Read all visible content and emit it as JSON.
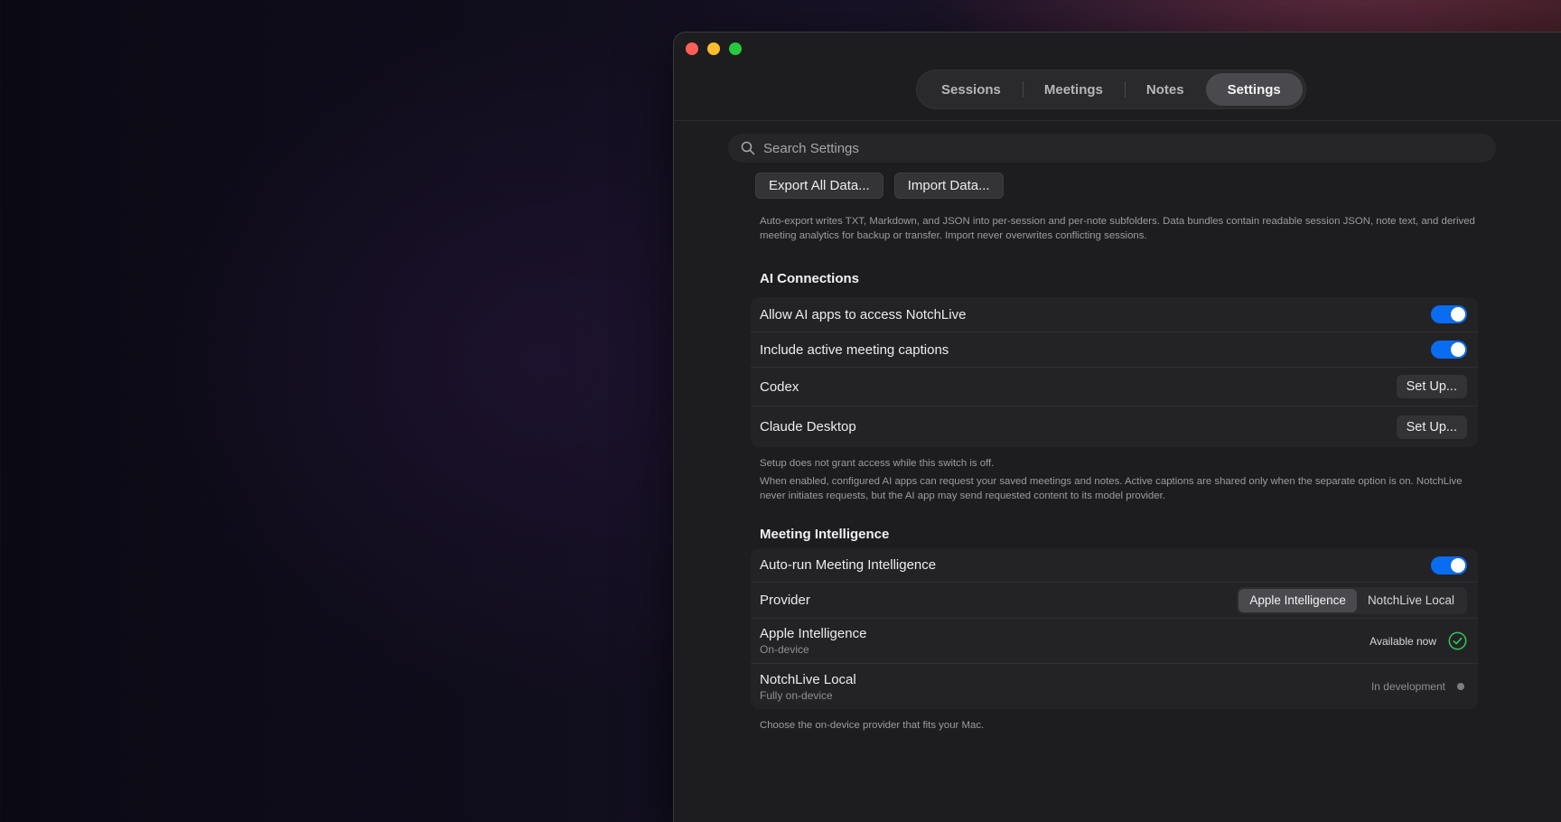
{
  "tabs": [
    {
      "label": "Sessions",
      "active": false
    },
    {
      "label": "Meetings",
      "active": false
    },
    {
      "label": "Notes",
      "active": false
    },
    {
      "label": "Settings",
      "active": true
    }
  ],
  "search": {
    "placeholder": "Search Settings",
    "value": ""
  },
  "data_buttons": {
    "export_label": "Export All Data...",
    "import_label": "Import Data..."
  },
  "data_note": "Auto-export writes TXT, Markdown, and JSON into per-session and per-note subfolders. Data bundles contain readable session JSON, note text, and derived meeting analytics for backup or transfer. Import never overwrites conflicting sessions.",
  "ai_connections": {
    "title": "AI Connections",
    "allow_label": "Allow AI apps to access NotchLive",
    "allow_on": true,
    "captions_label": "Include active meeting captions",
    "captions_on": true,
    "codex_label": "Codex",
    "codex_button": "Set Up...",
    "claude_label": "Claude Desktop",
    "claude_button": "Set Up...",
    "note1": "Setup does not grant access while this switch is off.",
    "note2": "When enabled, configured AI apps can request your saved meetings and notes. Active captions are shared only when the separate option is on. NotchLive never initiates requests, but the AI app may send requested content to its model provider."
  },
  "meeting_intelligence": {
    "title": "Meeting Intelligence",
    "autorun_label": "Auto-run Meeting Intelligence",
    "autorun_on": true,
    "provider_label": "Provider",
    "provider_options": [
      "Apple Intelligence",
      "NotchLive Local"
    ],
    "provider_selected": "Apple Intelligence",
    "apple": {
      "name": "Apple Intelligence",
      "sub": "On-device",
      "status": "Available now"
    },
    "local": {
      "name": "NotchLive Local",
      "sub": "Fully on-device",
      "status": "In development"
    },
    "note": "Choose the on-device provider that fits your Mac."
  },
  "colors": {
    "accent": "#0a6cf0",
    "success": "#34c759"
  },
  "icons": {
    "search": "search-icon",
    "check": "check-circle-icon",
    "dot": "status-dot-icon"
  }
}
